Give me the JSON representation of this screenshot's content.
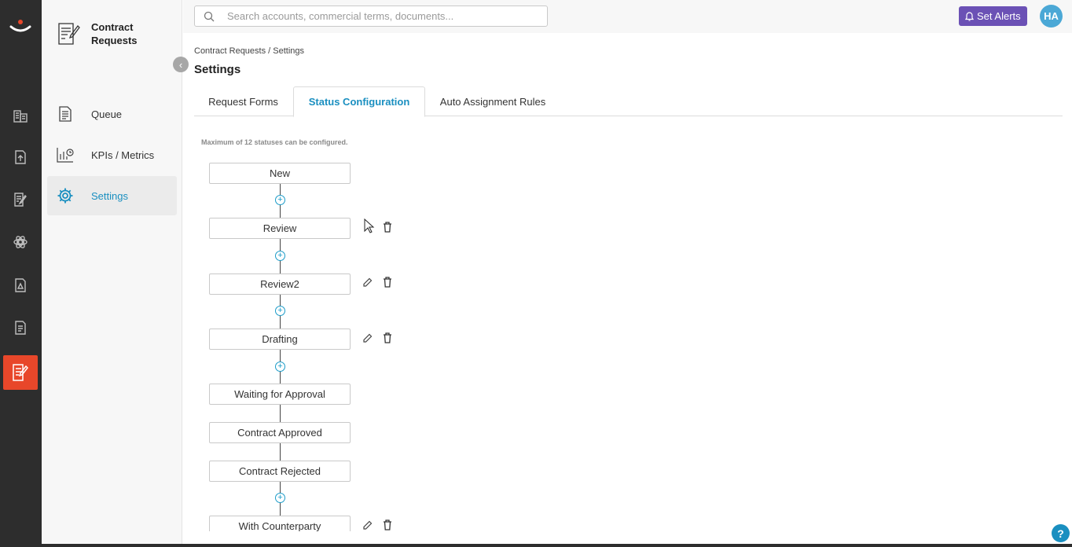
{
  "sidebar": {
    "title": "Contract Requests",
    "items": [
      {
        "label": "Queue",
        "icon": "document-list-icon"
      },
      {
        "label": "KPIs / Metrics",
        "icon": "chart-clock-icon"
      },
      {
        "label": "Settings",
        "icon": "gear-icon",
        "active": true
      }
    ]
  },
  "topbar": {
    "search_placeholder": "Search accounts, commercial terms, documents...",
    "alerts_label": "Set Alerts",
    "avatar_initials": "HA"
  },
  "breadcrumb": "Contract Requests / Settings",
  "page_title": "Settings",
  "tabs": [
    {
      "label": "Request Forms"
    },
    {
      "label": "Status Configuration",
      "active": true
    },
    {
      "label": "Auto Assignment Rules"
    }
  ],
  "hint": "Maximum of 12 statuses can be configured.",
  "statuses": [
    {
      "label": "New",
      "editable": false
    },
    {
      "label": "Review",
      "editable": true
    },
    {
      "label": "Review2",
      "editable": true
    },
    {
      "label": "Drafting",
      "editable": true
    },
    {
      "label": "Waiting for Approval",
      "editable": false
    },
    {
      "label": "Contract Approved",
      "editable": false
    },
    {
      "label": "Contract Rejected",
      "editable": false
    },
    {
      "label": "With Counterparty",
      "editable": true
    }
  ],
  "help_label": "?",
  "colors": {
    "accent": "#1a8fc0",
    "rail": "#2d2d2d",
    "rail_active": "#e8472a",
    "alerts_button": "#6b51b5",
    "avatar": "#4ba8d6"
  }
}
